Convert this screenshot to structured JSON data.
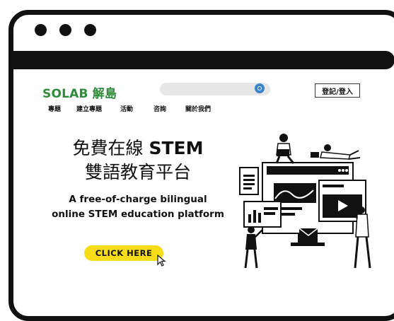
{
  "window": {
    "controls": [
      "close-dot",
      "minimize-dot",
      "maximize-dot"
    ]
  },
  "header": {
    "logo": "SOLAB 解島",
    "search_placeholder": "",
    "login_label": "登記/登入"
  },
  "nav": {
    "items": [
      "專題",
      "建立專題",
      "活動",
      "咨詢",
      "關於我們"
    ]
  },
  "hero": {
    "title_line1_prefix": "免費在線 ",
    "title_line1_bold": "STEM",
    "title_line2": "雙語教育平台",
    "subtitle_line1": "A free-of-charge bilingual",
    "subtitle_line2": "online STEM education platform",
    "cta_label": "CLICK HERE"
  },
  "colors": {
    "logo": "#2e8b3a",
    "cta_background": "#f7dc1a",
    "search_icon": "#3a84c9",
    "frame": "#111111"
  }
}
